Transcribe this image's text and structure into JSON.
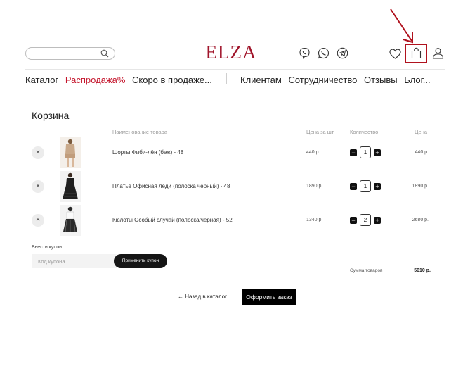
{
  "header": {
    "search": {
      "placeholder": "",
      "value": "",
      "icon": "search-icon"
    },
    "logo": "ELZA",
    "logo_color": "#a0142a",
    "social_icons": [
      "viber-icon",
      "whatsapp-icon",
      "telegram-icon"
    ],
    "user_icons": [
      "heart-icon",
      "bag-icon",
      "user-icon"
    ]
  },
  "nav": {
    "left": [
      "Каталог",
      "Распродажа%",
      "Скоро в продаже..."
    ],
    "right": [
      "Клиентам",
      "Сотрудничество",
      "Отзывы",
      "Блог..."
    ],
    "sale_color": "#c4142b"
  },
  "annotation": {
    "color": "#b0121e",
    "shapes": [
      "arrow",
      "highlight-box"
    ]
  },
  "cart": {
    "title": "Корзина",
    "columns": {
      "name": "Наименование товара",
      "unit_price": "Цена за шт.",
      "quantity": "Количество",
      "total": "Цена"
    },
    "items": [
      {
        "name": "Шорты Фиби-лён (беж) - 48",
        "unit_price": "440 р.",
        "quantity": "1",
        "total": "440 р.",
        "remove": "×",
        "minus": "−",
        "plus": "+"
      },
      {
        "name": "Платье Офисная леди (полоска чёрный) - 48",
        "unit_price": "1890 р.",
        "quantity": "1",
        "total": "1890 р.",
        "remove": "×",
        "minus": "−",
        "plus": "+"
      },
      {
        "name": "Кюлоты Особый случай (полоска/черная) - 52",
        "unit_price": "1340 р.",
        "quantity": "2",
        "total": "2680 р.",
        "remove": "×",
        "minus": "−",
        "plus": "+"
      }
    ],
    "coupon": {
      "label": "Ввести купон",
      "placeholder": "Код купона",
      "apply_label": "Применить купон"
    },
    "summary": {
      "label": "Сумма товаров",
      "value": "5010 р."
    },
    "back_label": "← Назад в каталог",
    "order_label": "Оформить заказ"
  }
}
